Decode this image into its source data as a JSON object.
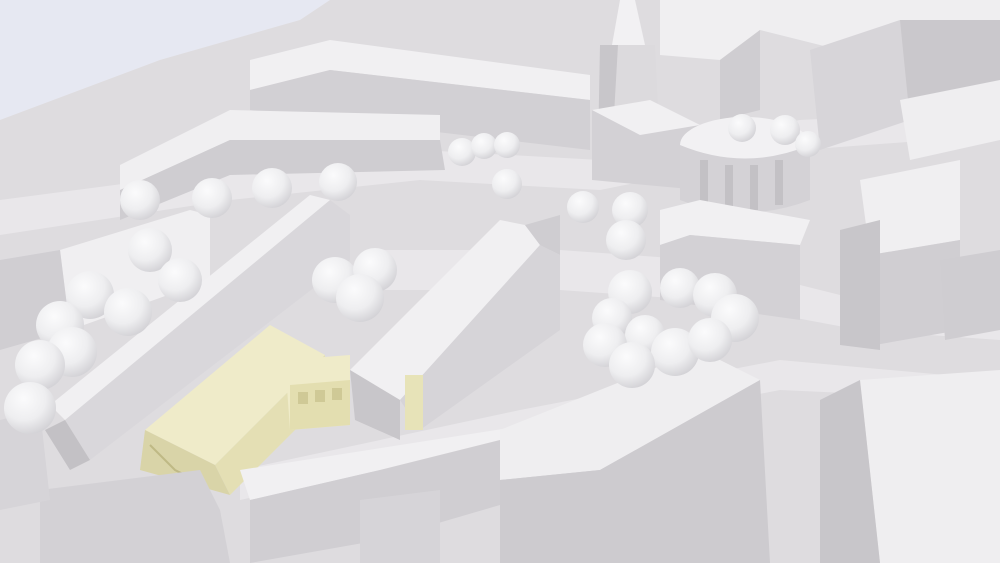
{
  "scene": {
    "kind": "urban-massing-model",
    "sky_color": "#e6e8f2",
    "ground_color": "#dedcdf",
    "street_color": "#e9e7ea",
    "building_roof_color": "#f1f0f2",
    "building_wall_light": "#d8d6d9",
    "building_wall_dark": "#c5c3c7",
    "tree_color": "#f3f3f4",
    "tree_shade_color": "#d9d8db",
    "highlight_building_color": "#efebc9",
    "highlight_building_shadow": "#d9d4a8",
    "glass_facade_color": "#e7e3b8"
  }
}
